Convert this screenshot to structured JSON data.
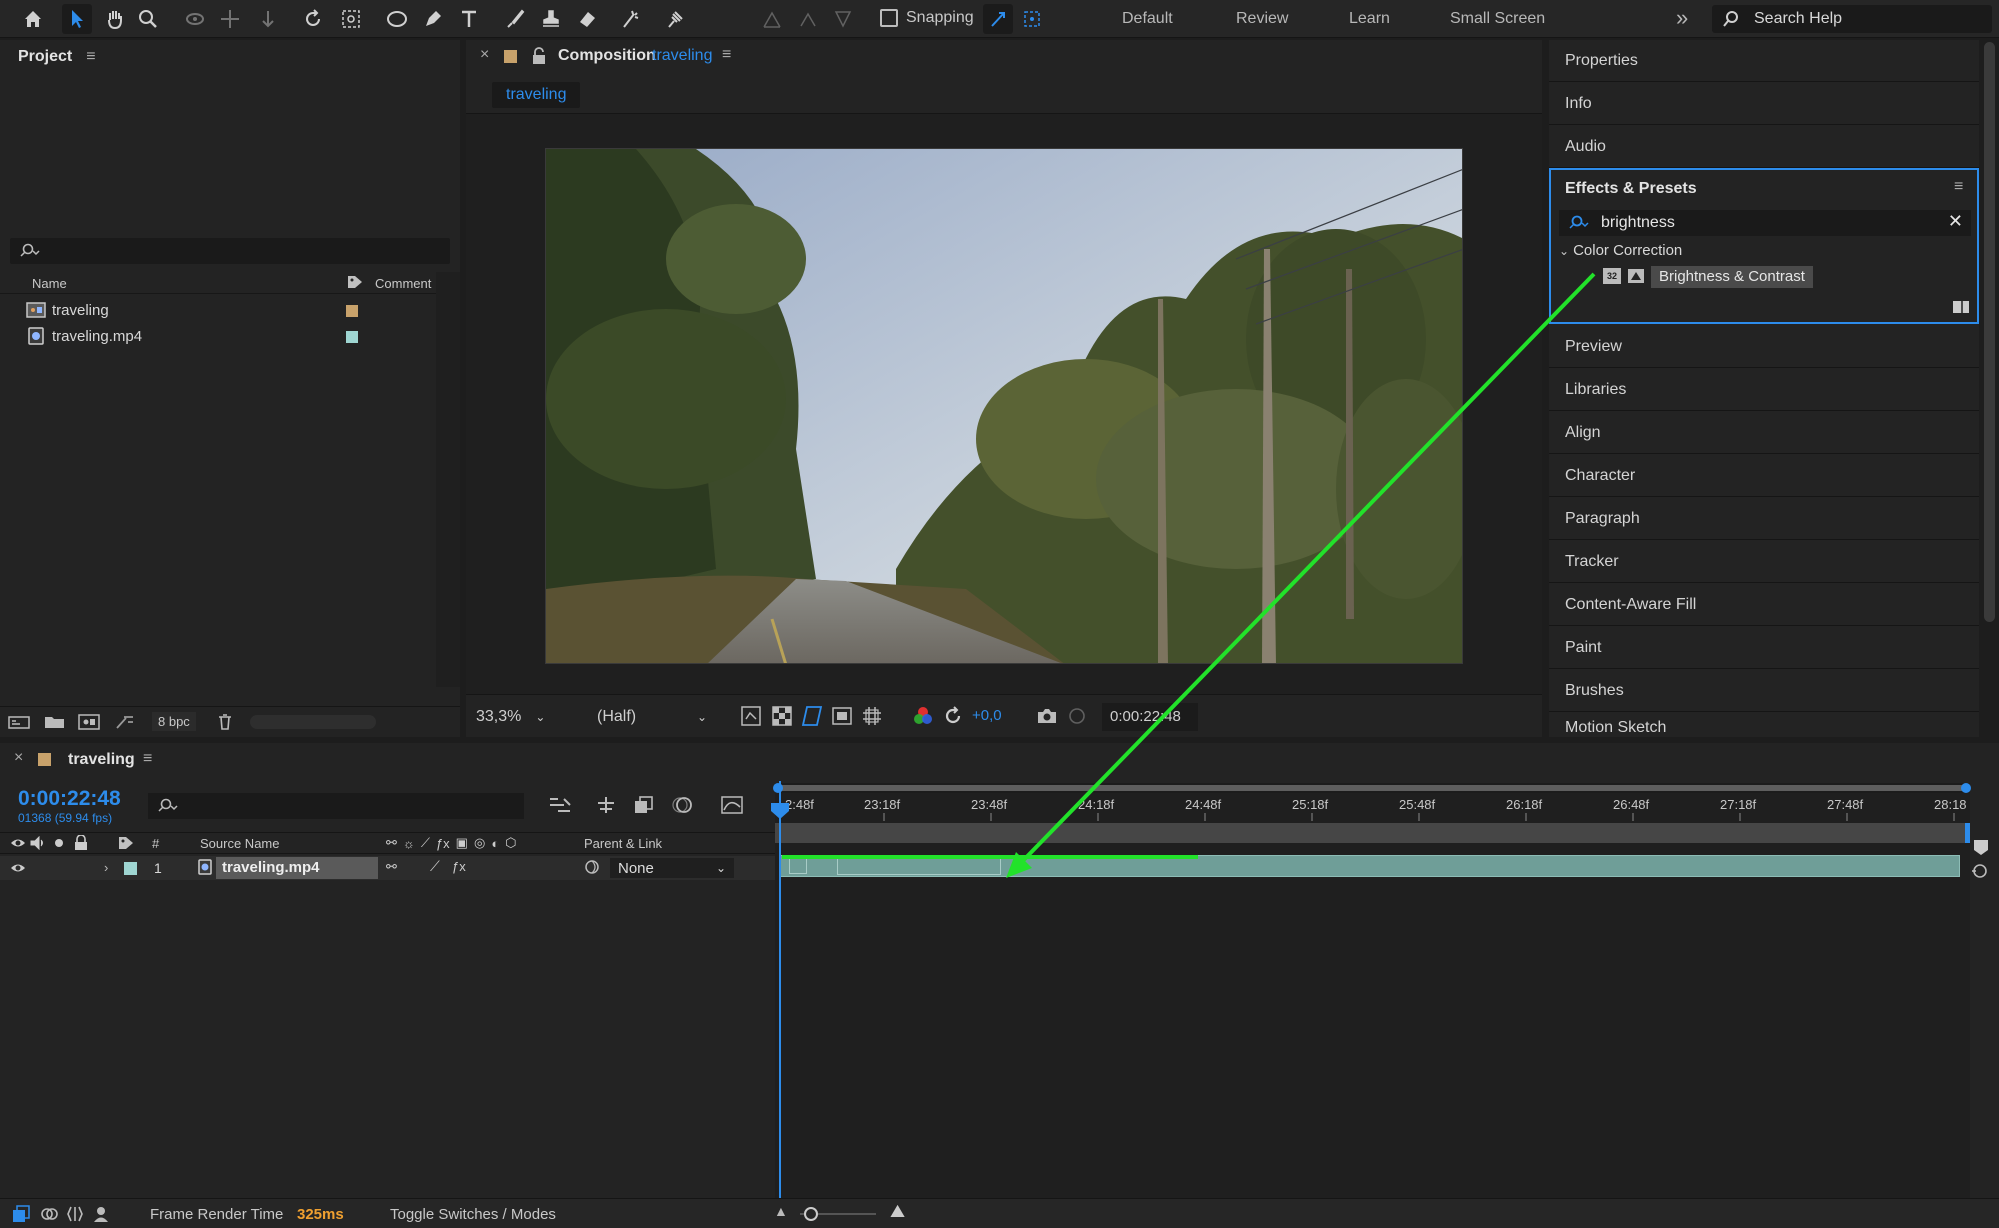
{
  "toolbar": {
    "snapping_label": "Snapping",
    "workspaces": [
      "Default",
      "Review",
      "Learn",
      "Small Screen"
    ],
    "more_glyph": "»",
    "search_placeholder": "Search Help"
  },
  "project": {
    "title": "Project",
    "columns": {
      "name": "Name",
      "comment": "Comment"
    },
    "items": [
      {
        "name": "traveling",
        "color": "#c8a26b",
        "icon": "composition-icon"
      },
      {
        "name": "traveling.mp4",
        "color": "#9fd6d2",
        "icon": "footage-icon"
      }
    ],
    "bpc_label": "8 bpc"
  },
  "composition": {
    "tab_prefix": "Composition",
    "comp_name": "traveling",
    "sub_tab": "traveling",
    "zoom": "33,3%",
    "resolution": "(Half)",
    "exposure": "+0,0",
    "timecode": "0:00:22:48"
  },
  "right_panels": {
    "top": [
      "Properties",
      "Info",
      "Audio"
    ],
    "effects": {
      "title": "Effects & Presets",
      "search_value": "brightness",
      "category": "Color Correction",
      "result": "Brightness & Contrast",
      "result_bit_label": "32"
    },
    "bottom": [
      "Preview",
      "Libraries",
      "Align",
      "Character",
      "Paragraph",
      "Tracker",
      "Content-Aware Fill",
      "Paint",
      "Brushes",
      "Motion Sketch"
    ]
  },
  "timeline": {
    "tab_name": "traveling",
    "timecode": "0:00:22:48",
    "frame_info": "01368 (59.94 fps)",
    "columns": {
      "hash": "#",
      "source_name": "Source Name",
      "parent_link": "Parent & Link"
    },
    "ruler": [
      "2:48f",
      "23:18f",
      "23:48f",
      "24:18f",
      "24:48f",
      "25:18f",
      "25:48f",
      "26:18f",
      "26:48f",
      "27:18f",
      "27:48f",
      "28:18"
    ],
    "layers": [
      {
        "number": "1",
        "source_name": "traveling.mp4",
        "parent": "None",
        "label_color": "#9fd6d2"
      }
    ]
  },
  "status": {
    "frame_render_label": "Frame Render Time",
    "frame_render_value": "325ms",
    "toggle_label": "Toggle Switches / Modes"
  },
  "colors": {
    "accent": "#2d8ceb",
    "annotation_arrow": "#22e22a",
    "layer_bar": "#6f9e98"
  }
}
